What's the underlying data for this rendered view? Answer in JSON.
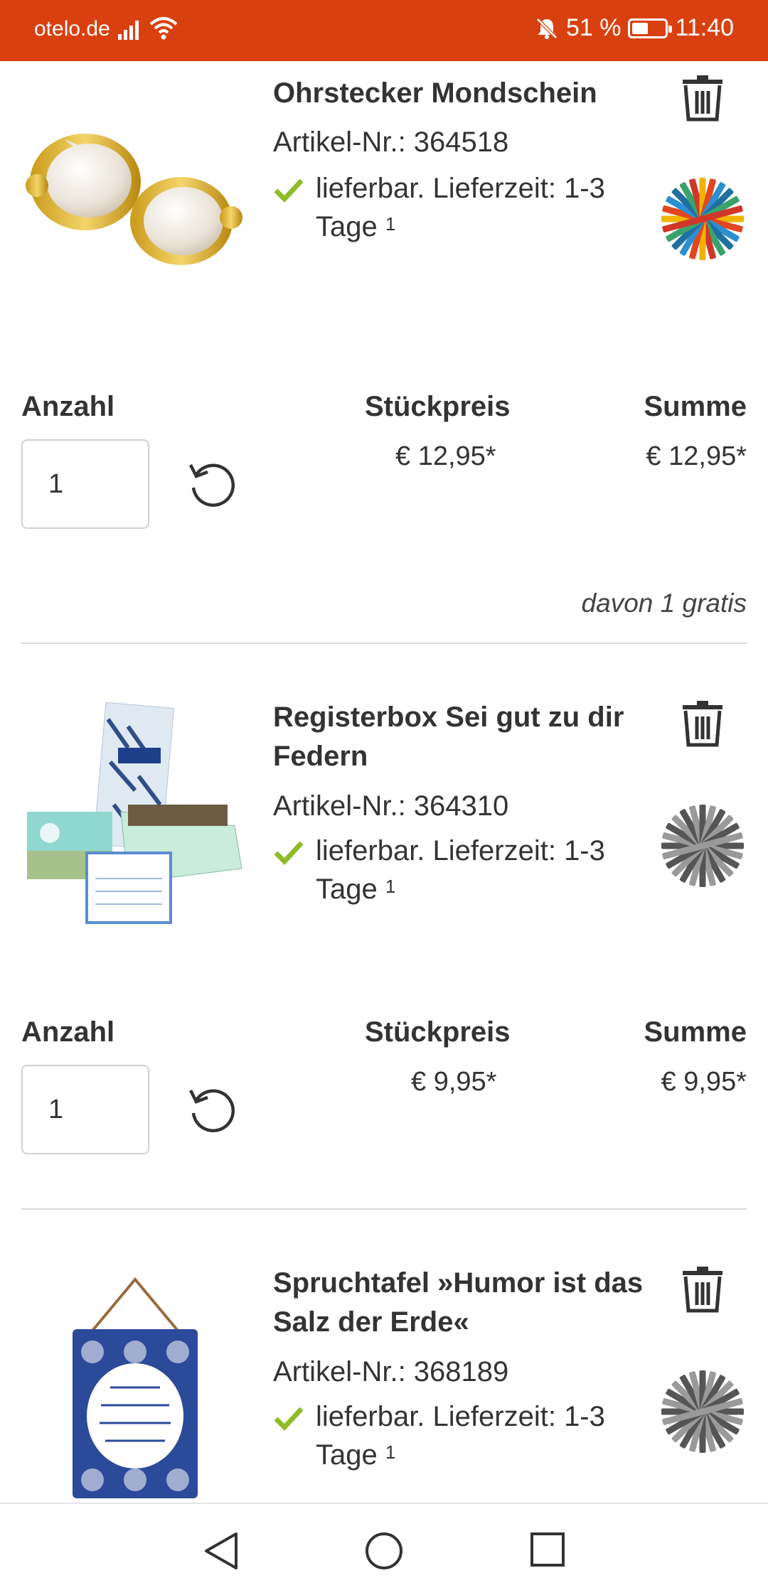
{
  "status_bar": {
    "carrier": "otelo.de",
    "battery": "51 %",
    "battery_level": 0.51,
    "time": "11:40",
    "icons": [
      "signal-icon",
      "wifi-icon",
      "mute-bell-icon",
      "battery-icon"
    ]
  },
  "cart": {
    "labels": {
      "quantity": "Anzahl",
      "unit_price": "Stückpreis",
      "total": "Summe"
    },
    "items": [
      {
        "title": "Ohrstecker Mondschein",
        "article_no": "Artikel-Nr.: 364518",
        "availability": "lieferbar. Lieferzeit: 1-3 Tage",
        "footnote": "1",
        "quantity": "1",
        "unit_price": "€ 12,95*",
        "total": "€ 12,95*",
        "note": "davon 1 gratis",
        "badge_colors": [
          "#f0b400",
          "#e2471f",
          "#2b8fd0",
          "#1f6fa0",
          "#3aa36c",
          "#d0372a"
        ]
      },
      {
        "title": "Registerbox Sei gut zu dir Federn",
        "article_no": "Artikel-Nr.: 364310",
        "availability": "lieferbar. Lieferzeit: 1-3 Tage",
        "footnote": "1",
        "quantity": "1",
        "unit_price": "€ 9,95*",
        "total": "€ 9,95*",
        "badge_colors": [
          "#555555",
          "#9a9a9a"
        ]
      },
      {
        "title": "Spruchtafel »Humor ist das Salz der Erde«",
        "article_no": "Artikel-Nr.: 368189",
        "availability": "lieferbar. Lieferzeit: 1-3 Tage",
        "footnote": "1",
        "badge_colors": [
          "#555555",
          "#9a9a9a"
        ]
      }
    ]
  },
  "colors": {
    "brand": "#d9400f",
    "check": "#8cbd28",
    "text": "#333333"
  },
  "nav_bar": {
    "icons": [
      "back-triangle-icon",
      "home-circle-icon",
      "recents-square-icon"
    ]
  }
}
